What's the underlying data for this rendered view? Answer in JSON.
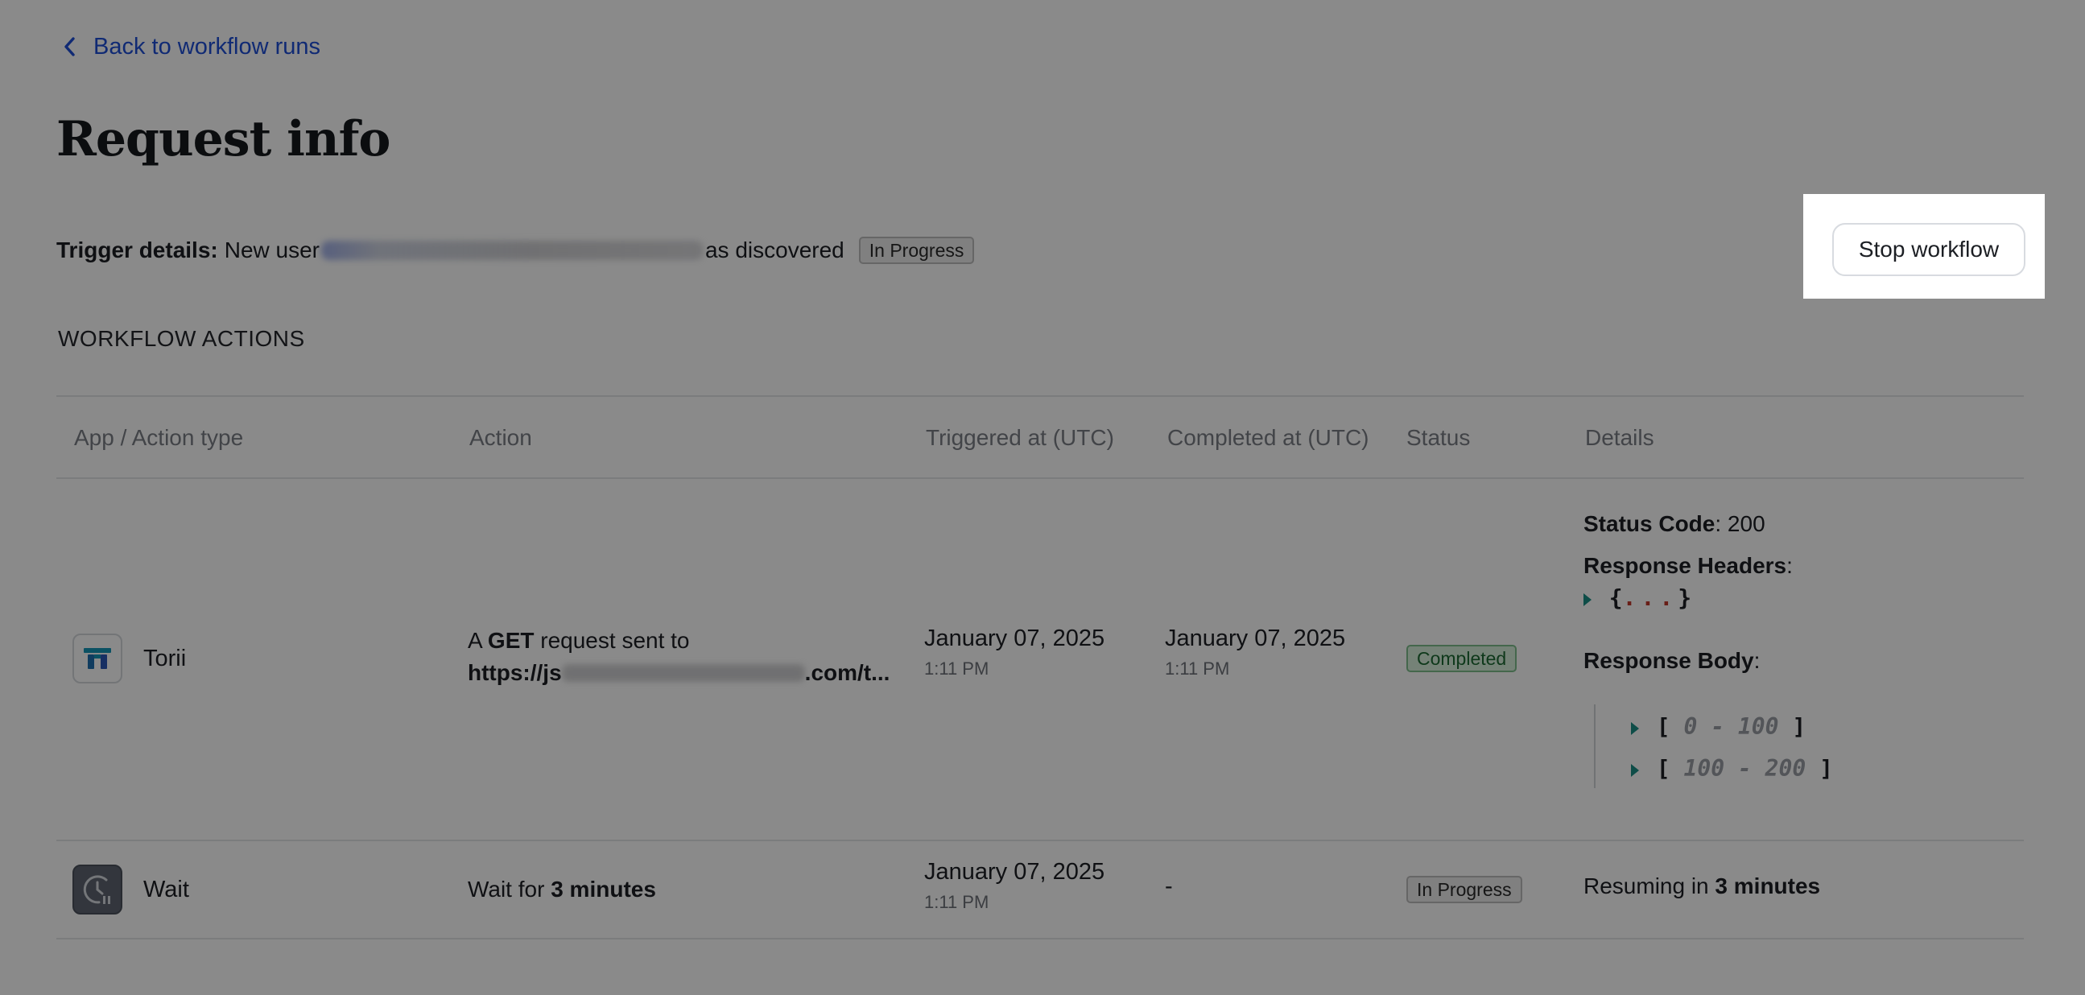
{
  "back_link": {
    "label": "Back to workflow runs"
  },
  "title": "Request info",
  "trigger": {
    "label": "Trigger details:",
    "text_before": "New user",
    "text_after": "as discovered",
    "status": "In Progress"
  },
  "stop_button": {
    "label": "Stop workflow"
  },
  "section_label": "WORKFLOW ACTIONS",
  "columns": [
    "App / Action type",
    "Action",
    "Triggered at (UTC)",
    "Completed at (UTC)",
    "Status",
    "Details"
  ],
  "rows": [
    {
      "app": "Torii",
      "action": {
        "prefix": "A",
        "method": "GET",
        "suffix": "request sent to",
        "url_start": "https://js",
        "url_end": ".com/t..."
      },
      "triggered": {
        "date": "January 07, 2025",
        "time": "1:11 PM"
      },
      "completed": {
        "date": "January 07, 2025",
        "time": "1:11 PM"
      },
      "status": "Completed",
      "details": {
        "status_code_label": "Status Code",
        "status_code": ": 200",
        "headers_label": "Response Headers",
        "colon": ":",
        "headers_open": "{",
        "headers_ellipsis": "...",
        "headers_close": "}",
        "body_label": "Response Body",
        "ranges": [
          "0 - 100",
          "100 - 200"
        ]
      }
    },
    {
      "app": "Wait",
      "action": {
        "prefix": "Wait for",
        "bold": "3 minutes"
      },
      "triggered": {
        "date": "January 07, 2025",
        "time": "1:11 PM"
      },
      "completed": {
        "dash": "-"
      },
      "status": "In Progress",
      "details": {
        "prefix": "Resuming in",
        "bold": "3 minutes"
      }
    }
  ],
  "colors": {
    "link": "#1f4fd6",
    "accent": "#1b8f86",
    "completed": "#1c6a33"
  },
  "icons": [
    "chevron-left-icon",
    "torii-logo-icon",
    "clock-pause-icon",
    "expand-caret-icon"
  ]
}
